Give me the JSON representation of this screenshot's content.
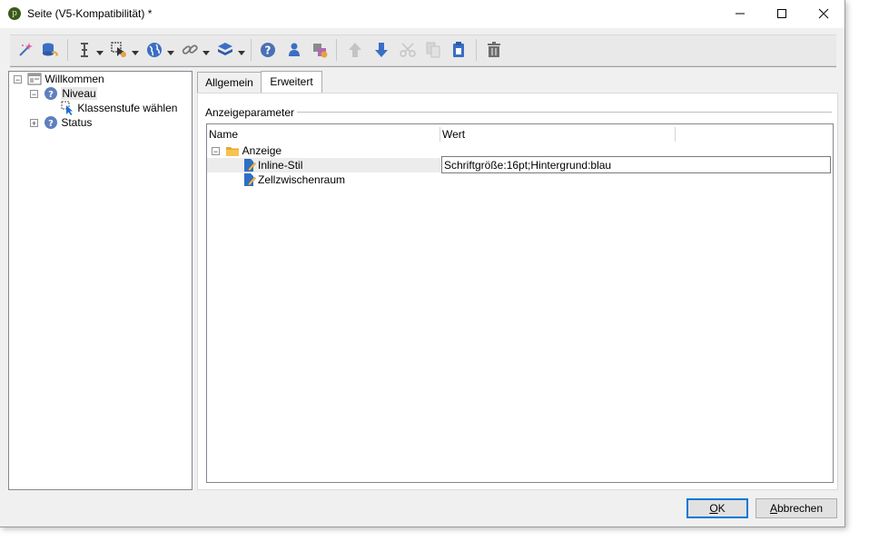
{
  "window": {
    "title": "Seite (V5-Kompatibilität) *"
  },
  "toolbar": {
    "icons": [
      "magic-wand-icon",
      "database-icon",
      "cursor-text-icon",
      "element-icon",
      "globe-icon",
      "link-icon",
      "stack-icon",
      "help-icon",
      "user-icon",
      "add-shape-icon",
      "arrow-up-icon",
      "arrow-down-icon",
      "cut-icon",
      "copy-icon",
      "paste-icon",
      "delete-icon"
    ]
  },
  "tree": {
    "root": {
      "label": "Willkommen"
    },
    "niveau": {
      "label": "Niveau"
    },
    "klassenstufe": {
      "label": "Klassenstufe wählen"
    },
    "status": {
      "label": "Status"
    }
  },
  "tabs": {
    "general": "Allgemein",
    "advanced": "Erweitert"
  },
  "panel": {
    "group_title": "Anzeigeparameter",
    "columns": {
      "name": "Name",
      "value": "Wert"
    },
    "folder": "Anzeige",
    "rows": [
      {
        "name": "Inline-Stil",
        "value": "Schriftgröße:16pt;Hintergrund:blau"
      },
      {
        "name": "Zellzwischenraum",
        "value": ""
      }
    ]
  },
  "buttons": {
    "ok_mnemonic": "O",
    "ok_rest": "K",
    "cancel_mnemonic": "A",
    "cancel_rest": "bbrechen"
  },
  "colors": {
    "accent": "#0078d7",
    "help_blue": "#4a6fb5",
    "folder": "#f5b73b"
  }
}
